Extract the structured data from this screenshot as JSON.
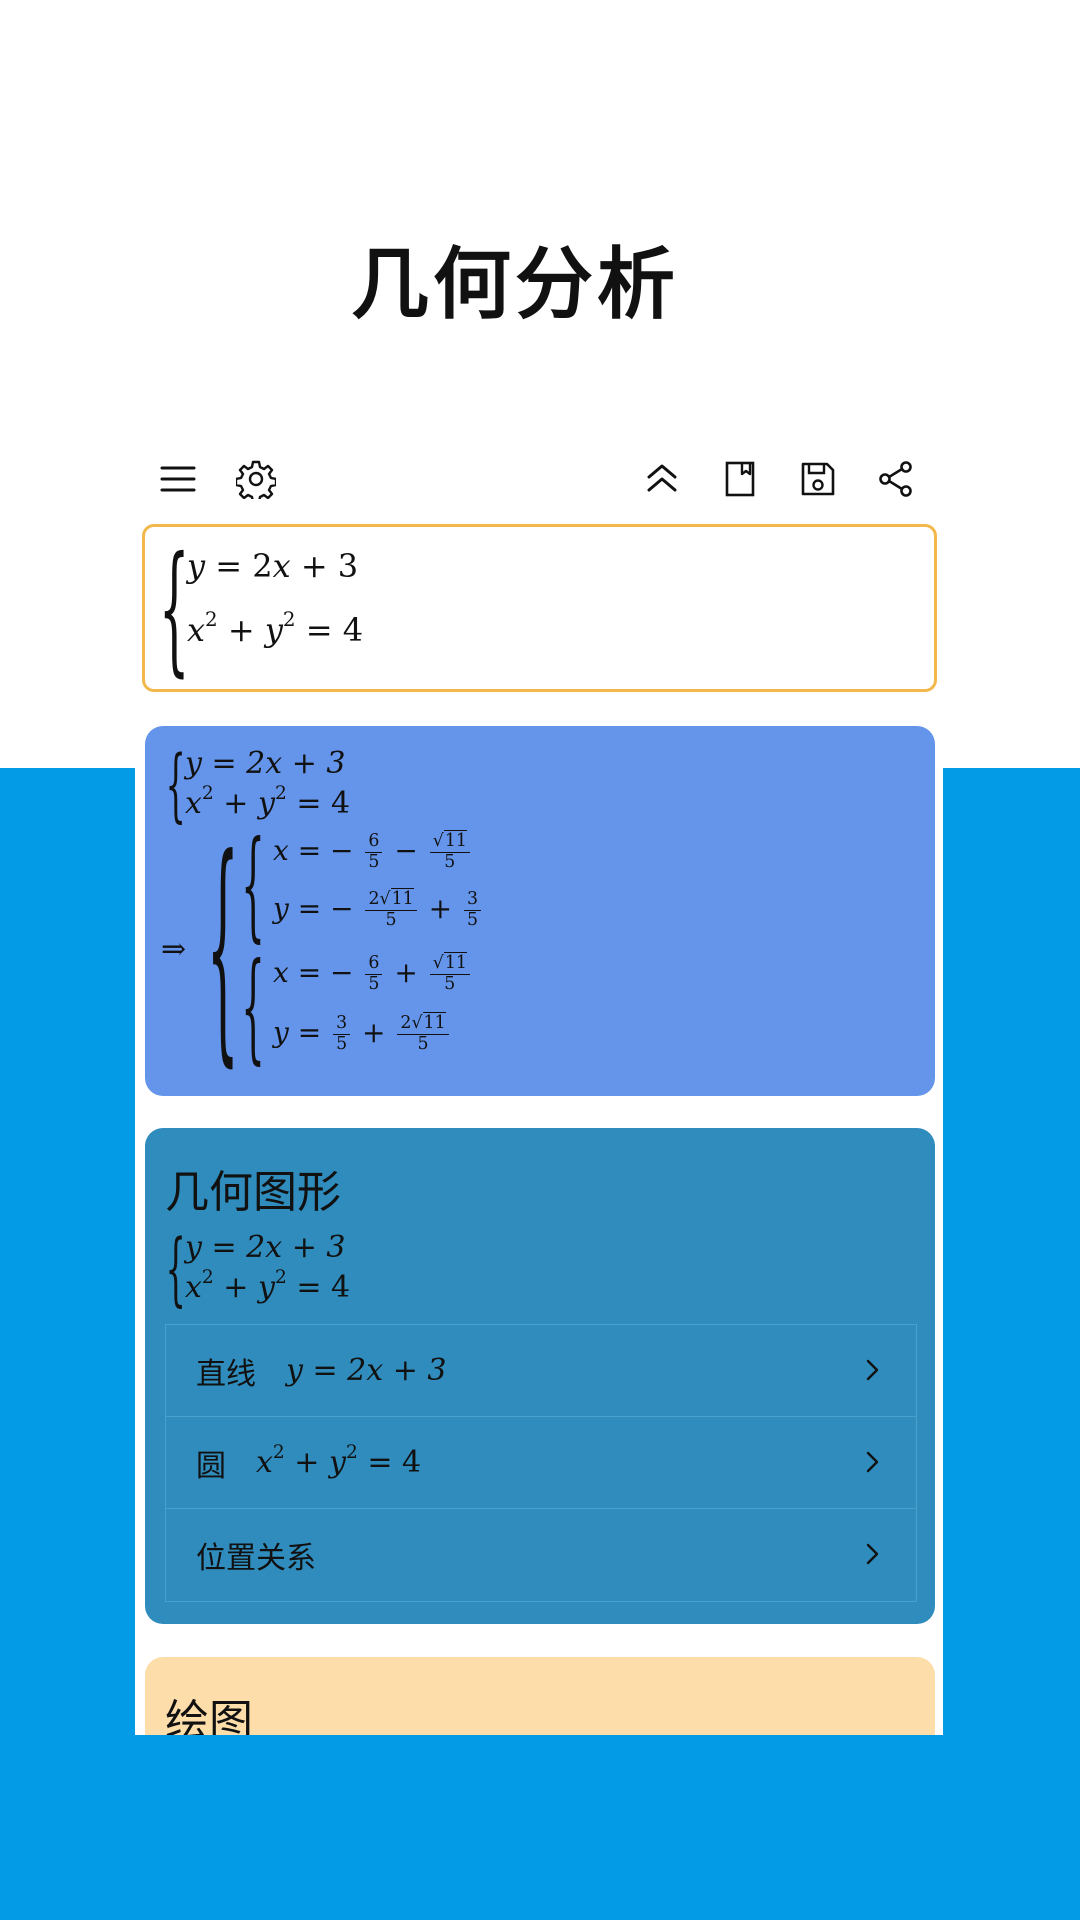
{
  "promo": {
    "title": "几何分析"
  },
  "toolbar": {
    "icons": [
      "menu-icon",
      "settings-icon",
      "collapse-up-icon",
      "bookmark-icon",
      "save-icon",
      "share-icon"
    ]
  },
  "input": {
    "line1": {
      "lhs": "y",
      "eq": "=",
      "rhs_num": "2",
      "rhs_var": "x",
      "plus": "+",
      "const": "3"
    },
    "line2": {
      "a": "x",
      "exp": "2",
      "plus": "+",
      "b": "y",
      "exp2": "2",
      "eq": "=",
      "const": "4"
    }
  },
  "solution": {
    "arrow": "⇒",
    "eq1": "y = 2x + 3",
    "eq2_base": "x",
    "eq2_plus": " + y",
    "eq2_rest": " = 4",
    "exp": "2",
    "sol1_x_prefix": "x = −",
    "sol1_y_prefix": "y = −",
    "sol2_x_prefix": "x = −",
    "sol2_y_prefix": "y = ",
    "minus": "−",
    "plus": "+",
    "six": "6",
    "three": "3",
    "two": "2",
    "five": "5",
    "eleven": "11",
    "sqrt": "√"
  },
  "geometry": {
    "title": "几何图形",
    "eq1": "y = 2x + 3",
    "eq2_base": "x",
    "eq2_plus": " + y",
    "eq2_rest": " = 4",
    "exp": "2",
    "rows": [
      {
        "label": "直线",
        "eq": "y = 2x + 3"
      },
      {
        "label": "圆",
        "eq_base": "x",
        "eq_plus": " + y",
        "eq_rest": " = 4",
        "exp": "2"
      },
      {
        "label": "位置关系"
      }
    ]
  },
  "plot": {
    "title": "绘图"
  },
  "colors": {
    "background_blue": "#039be5",
    "input_border": "#f2b84b",
    "solution_card": "#6495ea",
    "geometry_card": "#2f8cbc",
    "plot_card": "#fddeab"
  }
}
